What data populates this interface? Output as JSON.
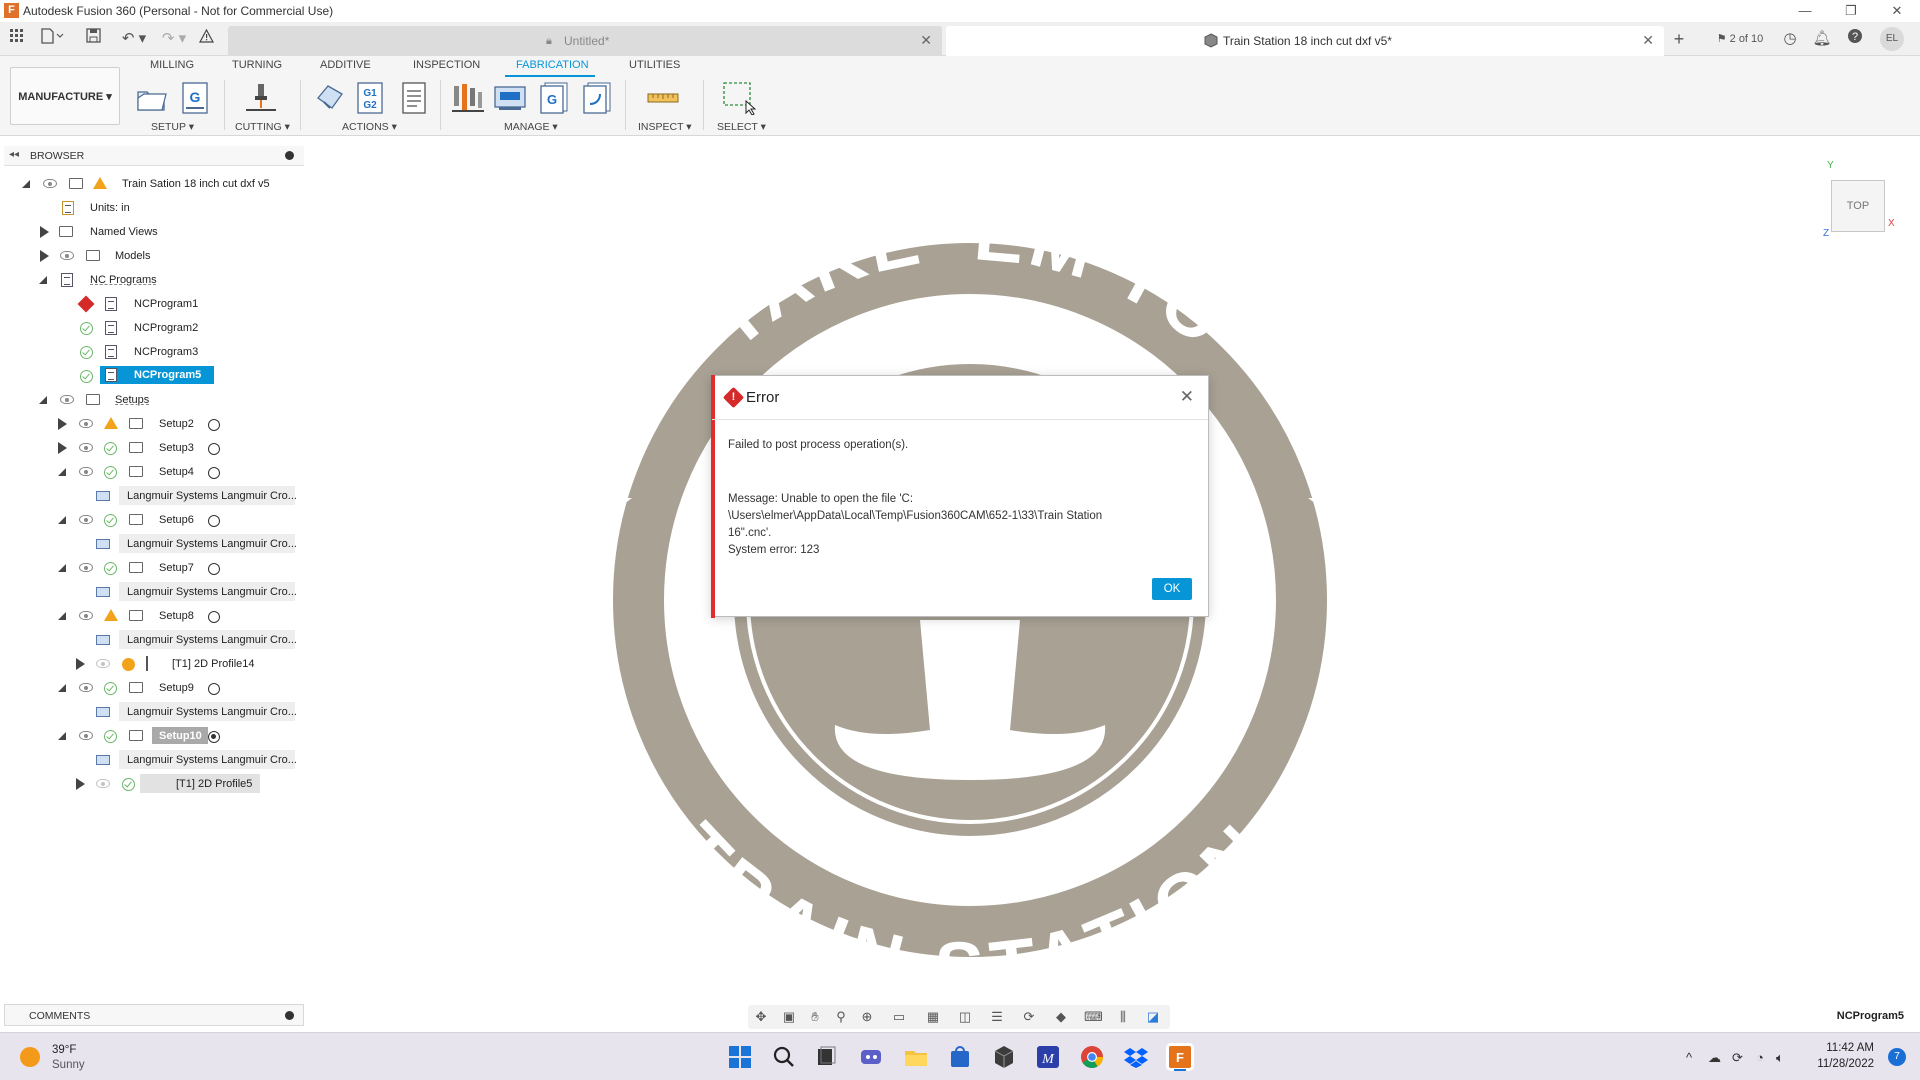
{
  "titlebar": {
    "logo": "F",
    "title": "Autodesk Fusion 360 (Personal - Not for Commercial Use)",
    "minimize": "—",
    "restore": "❐",
    "close": "✕"
  },
  "tabs": [
    {
      "label": "Untitled*",
      "active": false
    },
    {
      "label": "Train Station 18 inch cut dxf v5*",
      "active": true
    }
  ],
  "tab_close": "✕",
  "qat": {
    "new_tab": "+",
    "job_status": "2 of 10",
    "user_initials": "EL"
  },
  "ribbon": {
    "tabs": [
      "MILLING",
      "TURNING",
      "ADDITIVE",
      "INSPECTION",
      "FABRICATION",
      "UTILITIES"
    ],
    "active_tab": "FABRICATION",
    "workspace": "MANUFACTURE ▾",
    "groups": [
      "SETUP ▾",
      "CUTTING ▾",
      "ACTIONS ▾",
      "MANAGE ▾",
      "INSPECT ▾",
      "SELECT ▾"
    ]
  },
  "browser": {
    "title": "BROWSER",
    "root": "Train Sation 18 inch cut dxf v5",
    "units": "Units: in",
    "named_views": "Named Views",
    "models": "Models",
    "nc_programs": "NC Programs",
    "programs": [
      "NCProgram1",
      "NCProgram2",
      "NCProgram3",
      "NCProgram5"
    ],
    "setups": "Setups",
    "setup_items": [
      "Setup2",
      "Setup3",
      "Setup4",
      "Langmuir Systems Langmuir Cro...",
      "Setup6",
      "Langmuir Systems Langmuir Cro...",
      "Setup7",
      "Langmuir Systems Langmuir Cro...",
      "Setup8",
      "Langmuir Systems Langmuir Cro...",
      "[T1] 2D Profile14",
      "Setup9",
      "Langmuir Systems Langmuir Cro...",
      "Setup10",
      "Langmuir Systems Langmuir Cro...",
      "[T1] 2D Profile5"
    ]
  },
  "viewcube": {
    "face": "TOP",
    "x": "X",
    "y": "Y",
    "z": "Z"
  },
  "comments": {
    "title": "COMMENTS"
  },
  "active_program": "NCProgram5",
  "dialog": {
    "title": "Error",
    "line1": "Failed to post process operation(s).",
    "message_lines": [
      "Message: Unable to open the file 'C:",
      "\\Users\\elmer\\AppData\\Local\\Temp\\Fusion360CAM\\652-1\\33\\Train Station",
      "16\".cnc'.",
      "System error: 123"
    ],
    "ok": "OK",
    "close": "✕"
  },
  "sign": {
    "top_text": "TAKE 'EM TO",
    "bottom_text": "TRAIN STATION",
    "color": "#a8a194"
  },
  "taskbar": {
    "temperature": "39°F",
    "condition": "Sunny",
    "time": "11:42 AM",
    "date": "11/28/2022",
    "notifications": "7"
  }
}
